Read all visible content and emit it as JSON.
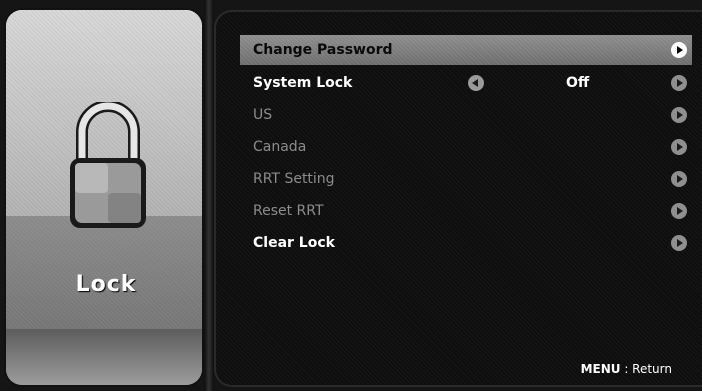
{
  "side_panel": {
    "icon": "padlock-icon",
    "title": "Lock"
  },
  "menu": {
    "items": [
      {
        "label": "Change Password",
        "state": "selected",
        "value": ""
      },
      {
        "label": "System Lock",
        "state": "enabled",
        "value": "Off"
      },
      {
        "label": "US",
        "state": "disabled",
        "value": ""
      },
      {
        "label": "Canada",
        "state": "disabled",
        "value": ""
      },
      {
        "label": "RRT Setting",
        "state": "disabled",
        "value": ""
      },
      {
        "label": "Reset RRT",
        "state": "disabled",
        "value": ""
      },
      {
        "label": "Clear Lock",
        "state": "enabled",
        "value": ""
      }
    ]
  },
  "footer": {
    "key": "MENU",
    "separator": " : ",
    "action": "Return"
  },
  "colors": {
    "selected_row": "#7d7d7d",
    "text": "#ffffff",
    "disabled_text": "#8c8c8c",
    "background": "#0e0e0e"
  }
}
